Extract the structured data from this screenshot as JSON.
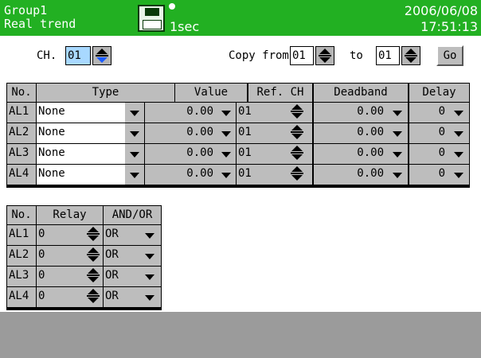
{
  "header": {
    "group": "Group1",
    "mode": "Real trend",
    "interval": "1sec",
    "date": "2006/06/08",
    "time": "17:51:13",
    "icon": "floppy-disk-icon",
    "bg_color": "#22b022"
  },
  "channel": {
    "label": "CH.",
    "value": "01",
    "copy_label": "Copy from",
    "copy_from": "01",
    "to_label": "to",
    "copy_to": "01",
    "go_label": "Go"
  },
  "alarm_table": {
    "headers": [
      "No.",
      "Type",
      "Value",
      "Ref. CH",
      "Deadband",
      "Delay"
    ],
    "rows": [
      {
        "no": "AL1",
        "type": "None",
        "value": "0.00",
        "ref_ch": "01",
        "deadband": "0.00",
        "delay": "0"
      },
      {
        "no": "AL2",
        "type": "None",
        "value": "0.00",
        "ref_ch": "01",
        "deadband": "0.00",
        "delay": "0"
      },
      {
        "no": "AL3",
        "type": "None",
        "value": "0.00",
        "ref_ch": "01",
        "deadband": "0.00",
        "delay": "0"
      },
      {
        "no": "AL4",
        "type": "None",
        "value": "0.00",
        "ref_ch": "01",
        "deadband": "0.00",
        "delay": "0"
      }
    ]
  },
  "relay_table": {
    "headers": [
      "No.",
      "Relay",
      "AND/OR"
    ],
    "rows": [
      {
        "no": "AL1",
        "relay": "0",
        "and_or": "OR"
      },
      {
        "no": "AL2",
        "relay": "0",
        "and_or": "OR"
      },
      {
        "no": "AL3",
        "relay": "0",
        "and_or": "OR"
      },
      {
        "no": "AL4",
        "relay": "0",
        "and_or": "OR"
      }
    ]
  }
}
